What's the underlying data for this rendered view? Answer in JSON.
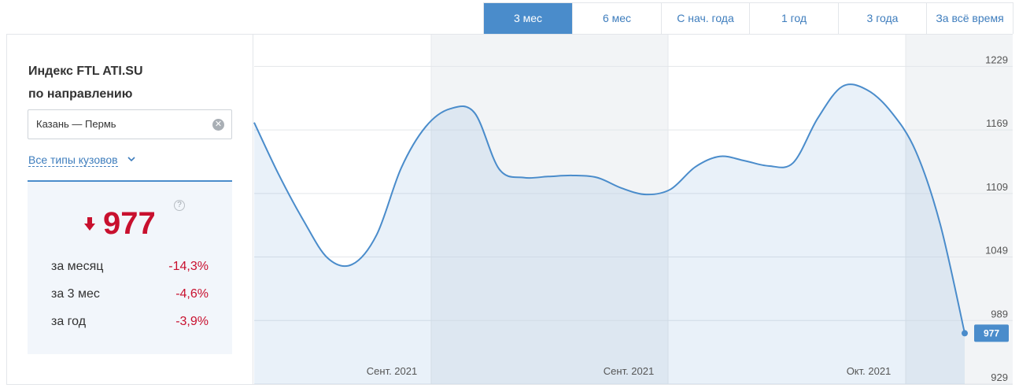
{
  "tabs": [
    {
      "label": "3 мес",
      "active": true
    },
    {
      "label": "6 мес",
      "active": false
    },
    {
      "label": "С нач. года",
      "active": false
    },
    {
      "label": "1 год",
      "active": false
    },
    {
      "label": "3 года",
      "active": false
    },
    {
      "label": "За всё время",
      "active": false
    }
  ],
  "panel": {
    "title_line1": "Индекс FTL ATI.SU",
    "title_line2": "по направлению",
    "route_value": "Казань — Пермь",
    "body_types_label": "Все типы кузовов",
    "current_value": "977",
    "help_label": "?",
    "stats": [
      {
        "label": "за месяц",
        "value": "-14,3%"
      },
      {
        "label": "за 3 мес",
        "value": "-4,6%"
      },
      {
        "label": "за год",
        "value": "-3,9%"
      }
    ]
  },
  "colors": {
    "accent": "#4a8ccb",
    "line": "#4a8ccb",
    "negative": "#c8102e"
  },
  "chart_data": {
    "type": "area",
    "title": "",
    "xlabel": "",
    "ylabel": "",
    "ylim": [
      929,
      1259
    ],
    "yticks": [
      1229,
      1169,
      1109,
      1049,
      989,
      929
    ],
    "month_labels": [
      "Сент. 2021",
      "Сент. 2021",
      "Окт. 2021"
    ],
    "last_value_label": "977",
    "series": [
      {
        "values": [
          1176,
          1127,
          1084,
          1048,
          1042,
          1070,
          1133,
          1172,
          1189,
          1185,
          1132,
          1124,
          1125,
          1126,
          1124,
          1114,
          1108,
          1113,
          1134,
          1144,
          1140,
          1135,
          1138,
          1180,
          1210,
          1207,
          1186,
          1149,
          1080,
          977
        ]
      }
    ],
    "grid": true,
    "shaded_bands": true
  }
}
